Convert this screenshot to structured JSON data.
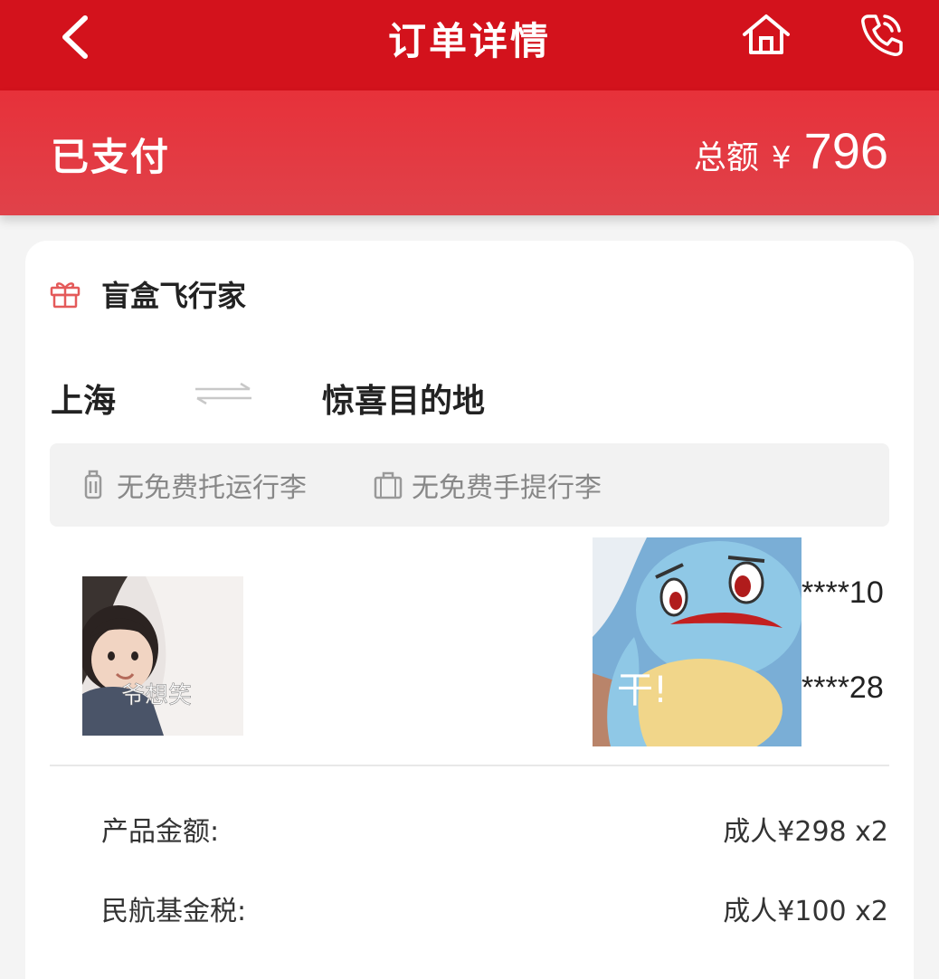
{
  "header": {
    "title": "订单详情",
    "back_icon": "chevron-left-icon",
    "home_icon": "home-icon",
    "phone_icon": "phone-icon"
  },
  "status": {
    "text": "已支付",
    "total_label": "总额",
    "currency": "¥",
    "total_amount": "796"
  },
  "product": {
    "icon": "gift-icon",
    "name": "盲盒飞行家"
  },
  "route": {
    "from": "上海",
    "to": "惊喜目的地",
    "icon": "swap-arrows-icon"
  },
  "baggage": {
    "checked": "无免费托运行李",
    "carry_on": "无免费手提行李"
  },
  "passengers": {
    "photo_left_caption": "爷想笑",
    "photo_right_caption": "干!",
    "ids": [
      "****10",
      "****28"
    ]
  },
  "fees": [
    {
      "label": "产品金额:",
      "value": "成人¥298 x2"
    },
    {
      "label": "民航基金税:",
      "value": "成人¥100 x2"
    }
  ],
  "colors": {
    "brand_red": "#d3121c",
    "band_red": "#e3383f"
  }
}
